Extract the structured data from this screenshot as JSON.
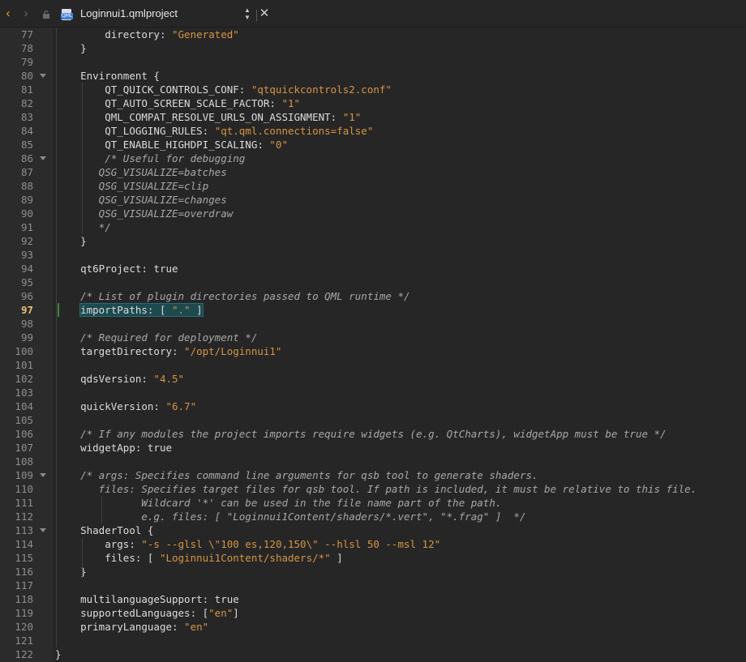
{
  "titlebar": {
    "back_icon": "‹",
    "forward_icon": "›",
    "filename": "Loginnui1.qmlproject",
    "file_icon_label": "QML",
    "updown_icon": "▲▼",
    "close_icon": "✕"
  },
  "editor": {
    "current_line": "97",
    "lines": [
      {
        "n": "77",
        "code": [
          [
            "    directory: ",
            ""
          ],
          [
            "\"Generated\"",
            "str"
          ]
        ]
      },
      {
        "n": "78",
        "code": [
          [
            "}",
            ""
          ]
        ]
      },
      {
        "n": "79",
        "code": []
      },
      {
        "n": "80",
        "fold": true,
        "code": [
          [
            "Environment {",
            ""
          ]
        ]
      },
      {
        "n": "81",
        "code": [
          [
            "    QT_QUICK_CONTROLS_CONF: ",
            ""
          ],
          [
            "\"qtquickcontrols2.conf\"",
            "str"
          ]
        ]
      },
      {
        "n": "82",
        "code": [
          [
            "    QT_AUTO_SCREEN_SCALE_FACTOR: ",
            ""
          ],
          [
            "\"1\"",
            "str"
          ]
        ]
      },
      {
        "n": "83",
        "code": [
          [
            "    QML_COMPAT_RESOLVE_URLS_ON_ASSIGNMENT: ",
            ""
          ],
          [
            "\"1\"",
            "str"
          ]
        ]
      },
      {
        "n": "84",
        "code": [
          [
            "    QT_LOGGING_RULES: ",
            ""
          ],
          [
            "\"qt.qml.connections=false\"",
            "str"
          ]
        ]
      },
      {
        "n": "85",
        "code": [
          [
            "    QT_ENABLE_HIGHDPI_SCALING: ",
            ""
          ],
          [
            "\"0\"",
            "str"
          ]
        ]
      },
      {
        "n": "86",
        "fold": true,
        "code": [
          [
            "    /* Useful for debugging",
            "com"
          ]
        ]
      },
      {
        "n": "87",
        "code": [
          [
            "   QSG_VISUALIZE=batches",
            "com"
          ]
        ]
      },
      {
        "n": "88",
        "code": [
          [
            "   QSG_VISUALIZE=clip",
            "com"
          ]
        ]
      },
      {
        "n": "89",
        "code": [
          [
            "   QSG_VISUALIZE=changes",
            "com"
          ]
        ]
      },
      {
        "n": "90",
        "code": [
          [
            "   QSG_VISUALIZE=overdraw",
            "com"
          ]
        ]
      },
      {
        "n": "91",
        "code": [
          [
            "   */",
            "com"
          ]
        ]
      },
      {
        "n": "92",
        "code": [
          [
            "}",
            ""
          ]
        ]
      },
      {
        "n": "93",
        "code": []
      },
      {
        "n": "94",
        "code": [
          [
            "qt6Project: true",
            ""
          ]
        ]
      },
      {
        "n": "95",
        "code": []
      },
      {
        "n": "96",
        "code": [
          [
            "/* List of plugin directories passed to QML runtime */",
            "com"
          ]
        ]
      },
      {
        "n": "97",
        "current": true,
        "code": [
          [
            "importPaths: [ ",
            ""
          ],
          [
            "\".\"",
            "str"
          ],
          [
            " ]",
            ""
          ]
        ]
      },
      {
        "n": "98",
        "code": []
      },
      {
        "n": "99",
        "code": [
          [
            "/* Required for deployment */",
            "com"
          ]
        ]
      },
      {
        "n": "100",
        "code": [
          [
            "targetDirectory: ",
            ""
          ],
          [
            "\"/opt/Loginnui1\"",
            "str"
          ]
        ]
      },
      {
        "n": "101",
        "code": []
      },
      {
        "n": "102",
        "code": [
          [
            "qdsVersion: ",
            ""
          ],
          [
            "\"4.5\"",
            "str"
          ]
        ]
      },
      {
        "n": "103",
        "code": []
      },
      {
        "n": "104",
        "code": [
          [
            "quickVersion: ",
            ""
          ],
          [
            "\"6.7\"",
            "str"
          ]
        ]
      },
      {
        "n": "105",
        "code": []
      },
      {
        "n": "106",
        "code": [
          [
            "/* If any modules the project imports require widgets (e.g. QtCharts), widgetApp must be true */",
            "com"
          ]
        ]
      },
      {
        "n": "107",
        "code": [
          [
            "widgetApp: true",
            ""
          ]
        ]
      },
      {
        "n": "108",
        "code": []
      },
      {
        "n": "109",
        "fold": true,
        "code": [
          [
            "/* args: Specifies command line arguments for qsb tool to generate shaders.",
            "com"
          ]
        ]
      },
      {
        "n": "110",
        "code": [
          [
            "   files: Specifies target files for qsb tool. If path is included, it must be relative to this file.",
            "com"
          ]
        ]
      },
      {
        "n": "111",
        "code": [
          [
            "          Wildcard '*' can be used in the file name part of the path.",
            "com"
          ]
        ]
      },
      {
        "n": "112",
        "code": [
          [
            "          e.g. files: [ \"Loginnui1Content/shaders/*.vert\", \"*.frag\" ]  */",
            "com"
          ]
        ]
      },
      {
        "n": "113",
        "fold": true,
        "code": [
          [
            "ShaderTool {",
            ""
          ]
        ]
      },
      {
        "n": "114",
        "code": [
          [
            "    args: ",
            ""
          ],
          [
            "\"-s --glsl \\\"100 es,120,150\\\" --hlsl 50 --msl 12\"",
            "str"
          ]
        ]
      },
      {
        "n": "115",
        "code": [
          [
            "    files: [ ",
            ""
          ],
          [
            "\"Loginnui1Content/shaders/*\"",
            "str"
          ],
          [
            " ]",
            ""
          ]
        ]
      },
      {
        "n": "116",
        "code": [
          [
            "}",
            ""
          ]
        ]
      },
      {
        "n": "117",
        "code": []
      },
      {
        "n": "118",
        "code": [
          [
            "multilanguageSupport: true",
            ""
          ]
        ]
      },
      {
        "n": "119",
        "code": [
          [
            "supportedLanguages: [",
            ""
          ],
          [
            "\"en\"",
            "str"
          ],
          [
            "]",
            ""
          ]
        ]
      },
      {
        "n": "120",
        "code": [
          [
            "primaryLanguage: ",
            ""
          ],
          [
            "\"en\"",
            "str"
          ]
        ]
      },
      {
        "n": "121",
        "code": []
      },
      {
        "n": "122",
        "code": [
          [
            "}",
            ""
          ]
        ],
        "outer": true
      }
    ]
  }
}
